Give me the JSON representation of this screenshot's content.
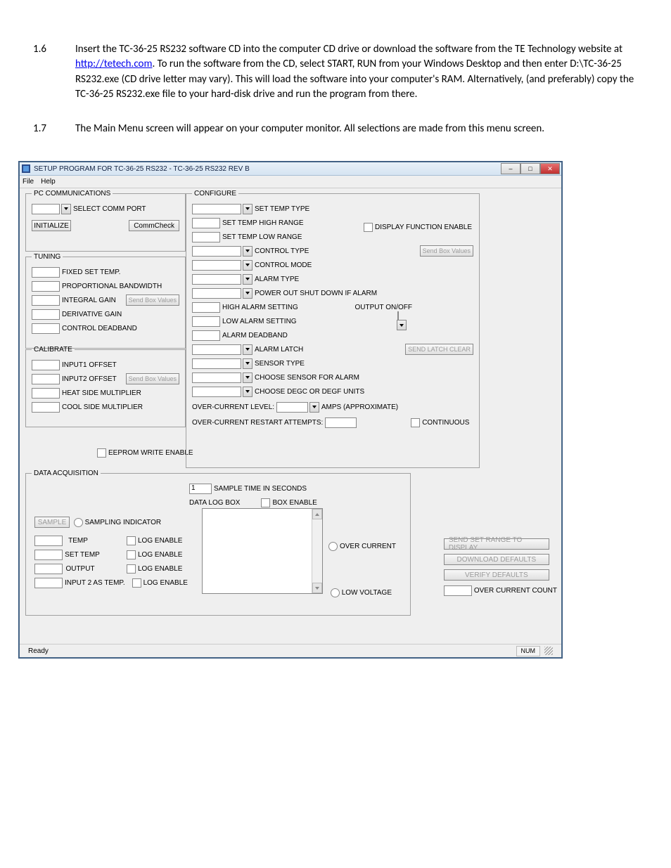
{
  "doc": {
    "step1_num": "1.6",
    "step1_pre": "Insert the TC-36-25 RS232 software CD into the computer CD drive or download the software from the TE Technology website at ",
    "step1_link": "http://tetech.com",
    "step1_post": ". To run the software from the CD, select START, RUN from your Windows Desktop and then enter D:\\TC-36-25 RS232.exe (CD drive letter may vary).  This will load the software into your computer's RAM.  Alternatively, (and preferably) copy the TC-36-25 RS232.exe file to your hard-disk drive and run the program from there.",
    "step2_num": "1.7",
    "step2_body": "The Main Menu screen will appear on your computer monitor. All selections are made from this menu screen."
  },
  "win": {
    "title": "SETUP PROGRAM FOR TC-36-25 RS232 - TC-36-25 RS232 REV B",
    "menu_file": "File",
    "menu_help": "Help",
    "status_ready": "Ready",
    "status_num": "NUM"
  },
  "pc": {
    "legend": "PC COMMUNICATIONS",
    "select_comm": "SELECT COMM PORT",
    "initialize": "INITIALIZE",
    "commcheck": "CommCheck"
  },
  "tuning": {
    "legend": "TUNING",
    "fixed_set": "FIXED SET TEMP.",
    "prop_bw": "PROPORTIONAL BANDWIDTH",
    "int_gain": "INTEGRAL GAIN",
    "der_gain": "DERIVATIVE GAIN",
    "deadband": "CONTROL DEADBAND",
    "send": "Send Box Values"
  },
  "cal": {
    "legend": "CALIBRATE",
    "in1": "INPUT1 OFFSET",
    "in2": "INPUT2 OFFSET",
    "heat": "HEAT SIDE MULTIPLIER",
    "cool": "COOL SIDE MULTIPLIER",
    "send": "Send Box Values"
  },
  "eeprom": "EEPROM WRITE ENABLE",
  "cfg": {
    "legend": "CONFIGURE",
    "set_temp_type": "SET TEMP TYPE",
    "set_high": "SET TEMP HIGH RANGE",
    "set_low": "SET TEMP LOW RANGE",
    "control_type": "CONTROL TYPE",
    "control_mode": "CONTROL MODE",
    "alarm_type": "ALARM TYPE",
    "power_out": "POWER OUT SHUT DOWN IF ALARM",
    "high_alarm": "HIGH ALARM SETTING",
    "low_alarm": "LOW ALARM SETTING",
    "alarm_db": "ALARM DEADBAND",
    "alarm_latch": "ALARM LATCH",
    "sensor_type": "SENSOR TYPE",
    "choose_sensor": "CHOOSE SENSOR FOR ALARM",
    "choose_units": "CHOOSE DEGC OR DEGF UNITS",
    "display_en": "DISPLAY FUNCTION ENABLE",
    "send": "Send Box Values",
    "output_onoff": "OUTPUT ON/OFF",
    "send_latch": "SEND LATCH CLEAR",
    "oc_level": "OVER-CURRENT LEVEL:",
    "amps": "AMPS (APPROXIMATE)",
    "oc_restart": "OVER-CURRENT RESTART ATTEMPTS:",
    "continuous": "CONTINUOUS"
  },
  "daq": {
    "legend": "DATA ACQUISITION",
    "sample_val": "1",
    "sample_time": "SAMPLE TIME IN SECONDS",
    "box_enable": "BOX ENABLE",
    "data_log_box": "DATA LOG BOX",
    "sample_btn": "SAMPLE",
    "sampling_ind": "SAMPLING INDICATOR",
    "temp": "TEMP",
    "set_temp": "SET TEMP",
    "output": "OUTPUT",
    "in2temp": "INPUT 2 AS TEMP.",
    "log_enable": "LOG ENABLE",
    "over_current": "OVER CURRENT",
    "low_voltage": "LOW VOLTAGE"
  },
  "side": {
    "send_set_range": "SEND SET RANGE TO DISPLAY",
    "dl_defaults": "DOWNLOAD DEFAULTS",
    "verify": "VERIFY DEFAULTS",
    "occ": "OVER CURRENT COUNT"
  }
}
